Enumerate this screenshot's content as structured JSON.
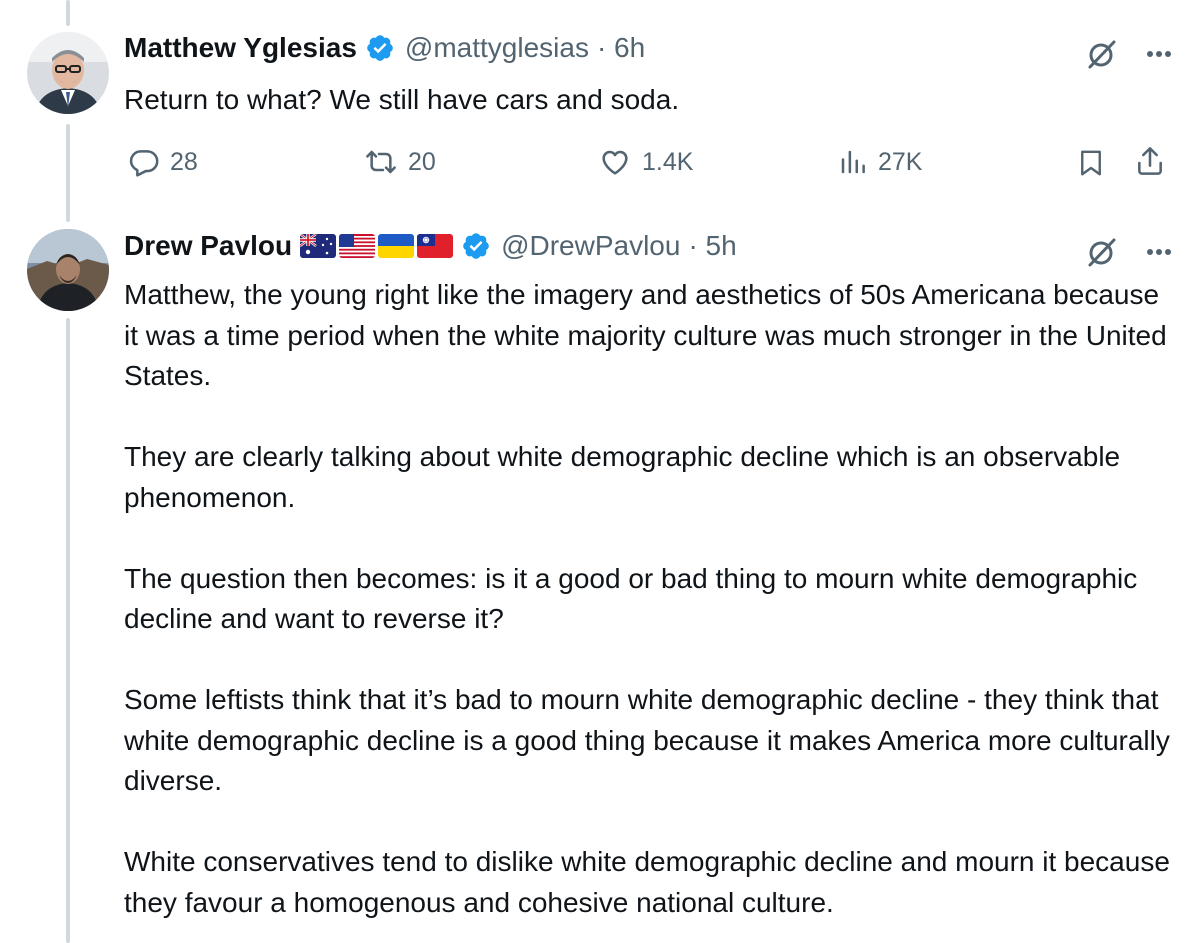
{
  "tweets": [
    {
      "author_name": "Matthew Yglesias",
      "handle": "@mattyglesias",
      "time": "· 6h",
      "text": [
        "Return to what? We still have cars and soda."
      ],
      "actions": {
        "replies": "28",
        "retweets": "20",
        "likes": "1.4K",
        "views": "27K"
      }
    },
    {
      "author_name": "Drew Pavlou",
      "flags": [
        "australia-flag",
        "usa-flag",
        "ukraine-flag",
        "taiwan-flag"
      ],
      "handle": "@DrewPavlou",
      "time": "· 5h",
      "text": [
        "Matthew, the young right like the imagery and aesthetics of 50s Americana because it was a time period when the white majority culture was much stronger in the United States.",
        "They are clearly talking about white demographic decline which is an observable phenomenon.",
        "The question then becomes: is it a good or bad thing to mourn white demographic decline and want to reverse it?",
        "Some leftists think that it’s bad to mourn white demographic decline - they think that white demographic decline is a good thing because it makes America more culturally diverse.",
        "White conservatives tend to dislike white demographic decline and mourn it because they favour a homogenous and cohesive national culture."
      ]
    }
  ],
  "colors": {
    "text": "#0f1419",
    "muted": "#536471",
    "verified": "#1d9bf0",
    "thread_line": "#cfd9de"
  },
  "icons": [
    "reply-icon",
    "retweet-icon",
    "like-icon",
    "views-icon",
    "bookmark-icon",
    "share-icon",
    "grok-icon",
    "more-icon",
    "verified-icon"
  ]
}
